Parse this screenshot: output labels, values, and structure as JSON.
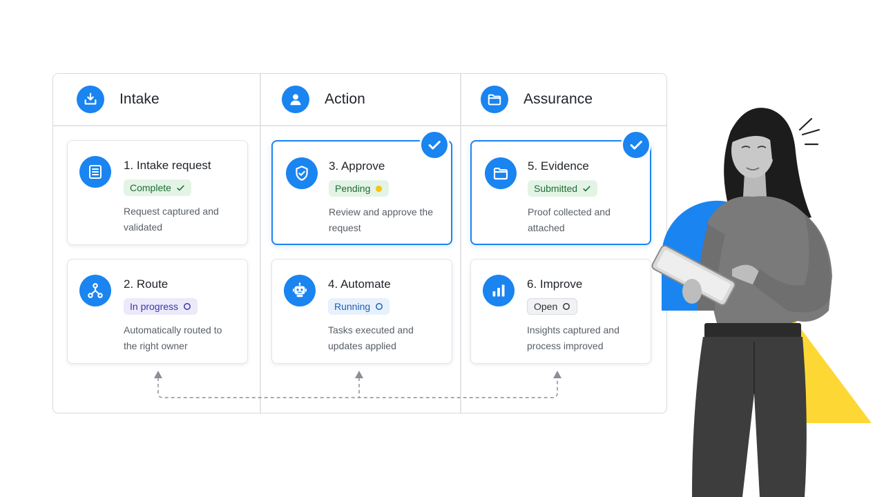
{
  "columns": [
    {
      "title": "Intake",
      "icon": "download-tray-icon"
    },
    {
      "title": "Action",
      "icon": "user-icon"
    },
    {
      "title": "Assurance",
      "icon": "folder-icon"
    }
  ],
  "cards": [
    {
      "title": "1. Intake request",
      "icon": "list-icon",
      "status": "Complete",
      "status_mark": "check",
      "description": "Request captured and validated",
      "selected": false
    },
    {
      "title": "2. Route",
      "icon": "route-branch-icon",
      "status": "In progress",
      "status_mark": "circle",
      "description": "Automatically routed to the right owner",
      "selected": false
    },
    {
      "title": "3. Approve",
      "icon": "shield-check-icon",
      "status": "Pending",
      "status_mark": "dot",
      "description": "Review and approve the request",
      "selected": true
    },
    {
      "title": "4. Automate",
      "icon": "robot-icon",
      "status": "Running",
      "status_mark": "circle",
      "description": "Tasks executed and updates applied",
      "selected": false
    },
    {
      "title": "5. Evidence",
      "icon": "folder-icon",
      "status": "Submitted",
      "status_mark": "check",
      "description": "Proof collected and attached",
      "selected": true
    },
    {
      "title": "6. Improve",
      "icon": "bar-chart-icon",
      "status": "Open",
      "status_mark": "circle",
      "description": "Insights captured and process improved",
      "selected": false
    }
  ],
  "colors": {
    "accent": "#1a84f0",
    "complete_bg": "#e3f4e7",
    "progress_bg": "#ece9fb",
    "pending_dot": "#f5c518",
    "running_bg": "#e6f1fd",
    "decor_yellow": "#fdd835",
    "decor_blue": "#1a84f0"
  },
  "illustration": "woman-holding-tablet"
}
